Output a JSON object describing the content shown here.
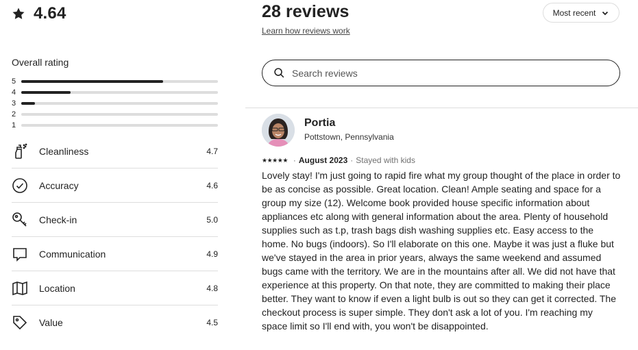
{
  "rating": {
    "value": "4.64"
  },
  "overall": {
    "title": "Overall rating",
    "distribution": [
      {
        "label": "5",
        "fraction": 0.72
      },
      {
        "label": "4",
        "fraction": 0.25
      },
      {
        "label": "3",
        "fraction": 0.07
      },
      {
        "label": "2",
        "fraction": 0.0
      },
      {
        "label": "1",
        "fraction": 0.0
      }
    ]
  },
  "categories": [
    {
      "name": "Cleanliness",
      "score": "4.7",
      "icon": "spray-bottle-icon"
    },
    {
      "name": "Accuracy",
      "score": "4.6",
      "icon": "check-circle-icon"
    },
    {
      "name": "Check-in",
      "score": "5.0",
      "icon": "key-icon"
    },
    {
      "name": "Communication",
      "score": "4.9",
      "icon": "chat-bubble-icon"
    },
    {
      "name": "Location",
      "score": "4.8",
      "icon": "map-icon"
    },
    {
      "name": "Value",
      "score": "4.5",
      "icon": "tag-icon"
    }
  ],
  "reviews_header": {
    "title": "28 reviews",
    "learn_link": "Learn how reviews work",
    "sort_label": "Most recent"
  },
  "search": {
    "placeholder": "Search reviews"
  },
  "review": {
    "name": "Portia",
    "location": "Pottstown, Pennsylvania",
    "stars": 5,
    "date": "August 2023",
    "stay_type": "Stayed with kids",
    "text": "Lovely stay! I'm just going to rapid fire what my group thought of the place in order to be as concise as possible. Great location. Clean! Ample seating and space for a group my size (12). Welcome book provided house specific information about appliances etc along with general information about the area. Plenty of household supplies such as t.p, trash bags dish washing supplies etc. Easy access to the home. No bugs (indoors). So I'll elaborate on this one. Maybe it was just a fluke but we've stayed in the area in prior years, always the same weekend and assumed bugs came with the territory. We are in the mountains after all. We did not have that experience at this property. On that note, they are committed to making their place better. They want to know if even a light bulb is out so they can get it corrected. The checkout process is super simple. They don't ask a lot of you. I'm reaching my space limit so I'll end with, you won't be disappointed."
  },
  "colors": {
    "text": "#222222",
    "muted": "#717171",
    "divider": "#dddddd",
    "bar_fill": "#222222"
  }
}
